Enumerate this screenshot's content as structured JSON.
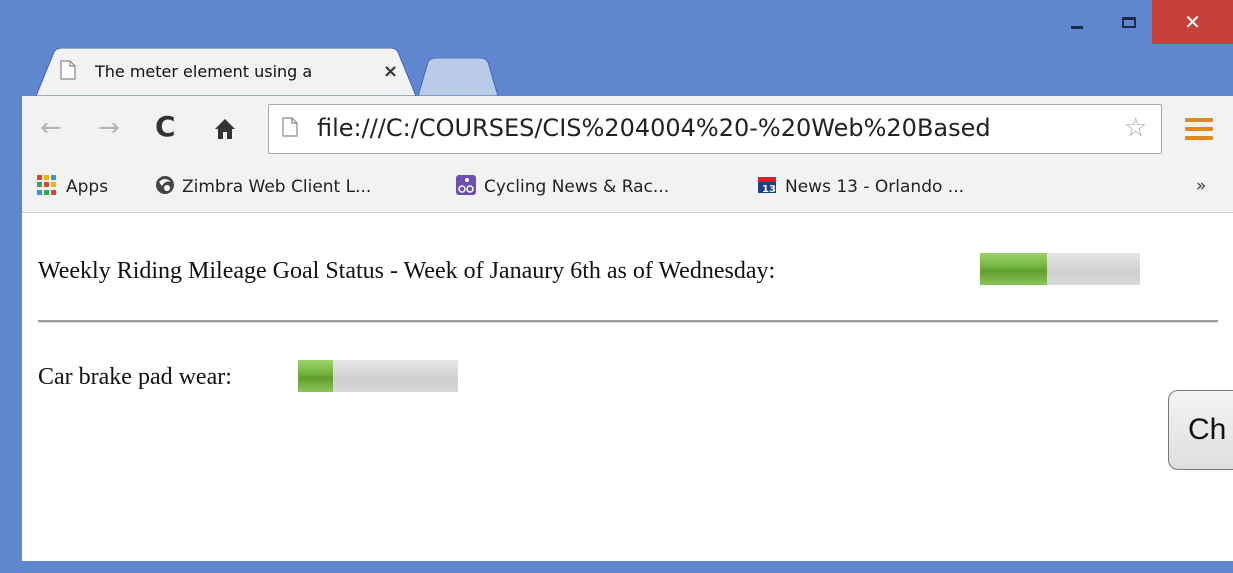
{
  "window": {
    "minimize_glyph": "",
    "close_glyph": "✕"
  },
  "tabs": [
    {
      "title": "The meter element using a",
      "close_glyph": "×"
    }
  ],
  "toolbar": {
    "back_glyph": "←",
    "forward_glyph": "→",
    "reload_glyph": "C",
    "home_glyph": "⌂",
    "url": "file:///C:/COURSES/CIS%204004%20-%20Web%20Based",
    "star_glyph": "☆"
  },
  "bookmarks": {
    "items": [
      {
        "label": "Apps",
        "icon": "apps-grid-icon"
      },
      {
        "label": "Zimbra Web Client L...",
        "icon": "zimbra-icon"
      },
      {
        "label": "Cycling News & Rac...",
        "icon": "cycling-icon"
      },
      {
        "label": "News 13 - Orlando ...",
        "icon": "news13-icon"
      }
    ],
    "more_glyph": "»"
  },
  "content": {
    "line1_label": "Weekly Riding Mileage Goal Status - Week of Janaury 6th as of Wednesday:",
    "meter1_value": 0.42,
    "line2_label": "Car brake pad wear:",
    "meter2_value": 0.22,
    "side_button_label": "Ch"
  },
  "colors": {
    "frame": "#5f86cf",
    "close_button": "#c7403a",
    "meter_fill": "#70b13c",
    "meter_track": "#d6d6d6",
    "menu_icon": "#e08a1e"
  }
}
